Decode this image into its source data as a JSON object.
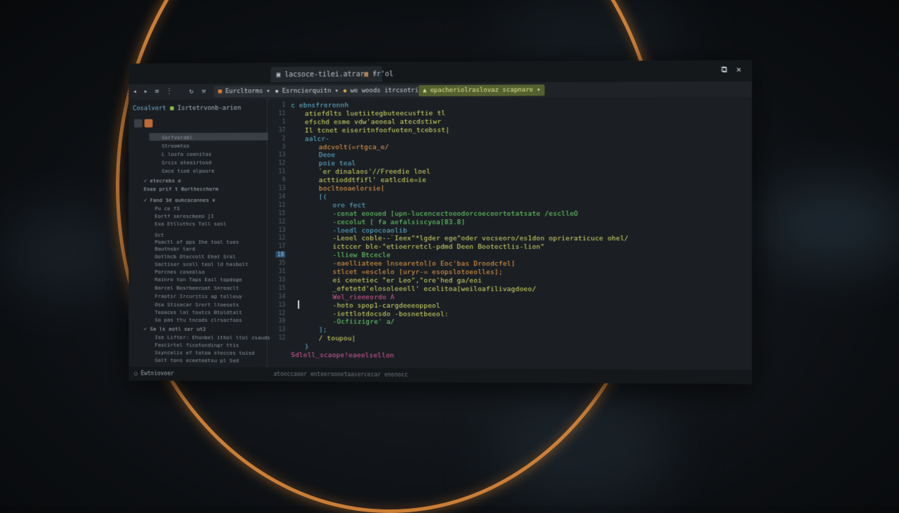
{
  "titlebar": {
    "tabs": [
      {
        "icon": "file-icon",
        "label": "lacsoce-tilei.atrare",
        "active": true,
        "close": "×"
      },
      {
        "icon": "grid-icon",
        "label": "fr'ol",
        "active": false,
        "close": ""
      }
    ],
    "controls": {
      "restore": "⧉",
      "close": "✕"
    }
  },
  "toolbar": {
    "items": [
      {
        "label": "Eurcltorms",
        "active": false
      },
      {
        "label": "Esrncierquitn",
        "active": false
      },
      {
        "label": "we woods itrcsotrie",
        "active": false
      },
      {
        "label": "epacheriolraslovaz scapnare",
        "active": true
      }
    ]
  },
  "sidebar": {
    "header": "Cosalvert",
    "header2": "Isrtetrvonb-arien",
    "lines": [
      {
        "text": "Serfvorabl",
        "sec": false
      },
      {
        "text": "Stroomtos",
        "sec": false
      },
      {
        "text": "L losfa ceenitos",
        "sec": false
      },
      {
        "text": "Srcis oteeirtosd",
        "sec": false
      },
      {
        "text": "Sace tiod olpoure",
        "sec": false
      },
      {
        "text": "✓ etecrebs e",
        "sec": true
      },
      {
        "text": "Esee prif t Bortheccherm",
        "sec": true
      },
      {
        "text": "✓ Fand 3d ouhcoconnes ∨",
        "sec": true
      },
      {
        "text": "Pu ce  f3",
        "sec": false
      },
      {
        "text": "Eortf serescbeeo [I",
        "sec": false
      },
      {
        "text": "Exa Etlluthcs Tall sosl",
        "sec": false
      },
      {
        "text": "Sct",
        "sec": false
      },
      {
        "text": "Poactl of pps Ihe tool tues",
        "sec": false
      },
      {
        "text": "Bauthsbr tard",
        "sec": false
      },
      {
        "text": "Ootlhcb Oteccolt Ehat Srol",
        "sec": false
      },
      {
        "text": "Sactisor scell teol ld hasbolt",
        "sec": false
      },
      {
        "text": "Porcnes coseolsa",
        "sec": false
      },
      {
        "text": "Rainre ton Taps Eail topdoge",
        "sec": false
      },
      {
        "text": "Barcel Bosrbeecoat Snreaclt",
        "sec": false
      },
      {
        "text": "Fraotir Ircuritis ag tolleuy",
        "sec": false
      },
      {
        "text": "Osa Stisacar Srert ltoesets",
        "sec": false
      },
      {
        "text": "Teoaces lal toutcs Btoldtalt",
        "sec": false
      },
      {
        "text": "So pas ttu tncods clrsocfoos",
        "sec": false
      },
      {
        "text": "✓ Sa ls aotl ser ut2",
        "sec": true
      },
      {
        "text": "Ise Lifter: Ehunbel ithol ltol zsauds",
        "sec": false
      },
      {
        "text": "Fascirtel ficotocdingr ttis",
        "sec": false
      },
      {
        "text": "Ssyncelis ef totoa steccos toisd",
        "sec": false
      },
      {
        "text": "Solt tons eceeteetsu pl Sed",
        "sec": false
      }
    ]
  },
  "editor": {
    "line_numbers": [
      "1",
      "11",
      "1",
      "37",
      "2",
      "3",
      "13",
      "12",
      "11",
      "9",
      "13",
      "14",
      "11",
      "15",
      "12",
      "13",
      "12",
      "17",
      "18",
      "35",
      "31",
      "33",
      "15",
      "14",
      "13",
      "12",
      "39",
      "13",
      "12"
    ],
    "current_line_index": 18,
    "lines": [
      {
        "indent": 0,
        "color": "#5fb8d8",
        "text": "c  ebnsfreronnh"
      },
      {
        "indent": 1,
        "color": "#d8dd6a",
        "text": "atiefdlts luetiitegbuteecusftie tl"
      },
      {
        "indent": 1,
        "color": "#d8dd6a",
        "text": "efschd  esme  vdw'aeoeal  atecdstiwr"
      },
      {
        "indent": 1,
        "color": "#d8dd6a",
        "text": "Il  tcnet  eiseritnfoofueten_tcebsst|"
      },
      {
        "indent": 1,
        "color": "#5fb8d8",
        "text": "aalcr-"
      },
      {
        "indent": 2,
        "color": "#f0a04a",
        "text": "adcvolt(=rtgca_e/"
      },
      {
        "indent": 2,
        "color": "#5fb8d8",
        "text": "Deoe"
      },
      {
        "indent": 2,
        "color": "#5fb8d8",
        "text": "poie  teal"
      },
      {
        "indent": 2,
        "color": "#d8dd6a",
        "text": " `er dinalaos'//Freedie  loel"
      },
      {
        "indent": 2,
        "color": "#d8dd6a",
        "text": "acttioddtfifl' eatlcdie=ie"
      },
      {
        "indent": 2,
        "color": "#f0a04a",
        "text": "bocltooaelorsie["
      },
      {
        "indent": 2,
        "color": "#5fb8d8",
        "text": "[("
      },
      {
        "indent": 3,
        "color": "#5fb8d8",
        "text": "ore  fect"
      },
      {
        "indent": 3,
        "color": "#6fd870",
        "text": "-cenat eooued  [upn-lucencectoeodorcoeceortetatsate /esclleO"
      },
      {
        "indent": 3,
        "color": "#6fd870",
        "text": "-cecolut   [ fa  aefalsiscyoa[83.8]"
      },
      {
        "indent": 3,
        "color": "#5fb8d8",
        "text": "-loedl  copocoaolib"
      },
      {
        "indent": 3,
        "color": "#d8dd6a",
        "text": "-Leoel  coble--`Ieex\"*lgder ege\"oder vocseoro/es1don  oprieraticuce  ohel/"
      },
      {
        "indent": 3,
        "color": "#d8dd6a",
        "text": "ictccer  ble-\"etioerretcl-pdmd  Deen Bootectlis-lion\""
      },
      {
        "indent": 3,
        "color": "#6fd870",
        "text": "-lliew  Btcecle"
      },
      {
        "indent": 3,
        "color": "#f0a04a",
        "text": "-eaelliateee  lnsearetol[o  Eoc'bas  Droodcfel]"
      },
      {
        "indent": 3,
        "color": "#f0a04a",
        "text": " stlcet  =esclelo  [uryr-=  esopslotoeolles];"
      },
      {
        "indent": 3,
        "color": "#d8dd6a",
        "text": " ei  cenetiec  \"er  Leo\",\"ore'hed  ga/eoi"
      },
      {
        "indent": 3,
        "color": "#d8dd6a",
        "text": "_efetetd'elosoleeell' ecelitoa[weiloafilivagdoeo/"
      },
      {
        "indent": 3,
        "color": "#e05aa0",
        "text": "Wel_rieeeordo  A"
      },
      {
        "indent": 3,
        "color": "#d8dd6a",
        "text": "-hoto  spop1-cargdeeeoppeol"
      },
      {
        "indent": 3,
        "color": "#d8dd6a",
        "text": "-iettlotdocsdo  -bosnetbeeol:"
      },
      {
        "indent": 3,
        "color": "#6fd870",
        "text": "-Ocfiizigre'  a/"
      },
      {
        "indent": 2,
        "color": "#5fb8d8",
        "text": "];"
      },
      {
        "indent": 2,
        "color": "#d8dd6a",
        "text": "/ toupou|"
      },
      {
        "indent": 1,
        "color": "#5fb8d8",
        "text": "}"
      },
      {
        "indent": 0,
        "color": "#e05aa0",
        "text": "Sdlell_scaope!eaeelsellon"
      }
    ]
  },
  "statusbar": {
    "left": "Ewtniovoer",
    "mid": "atooccaoer   enteeroooetaasercecar  eneoocc"
  }
}
